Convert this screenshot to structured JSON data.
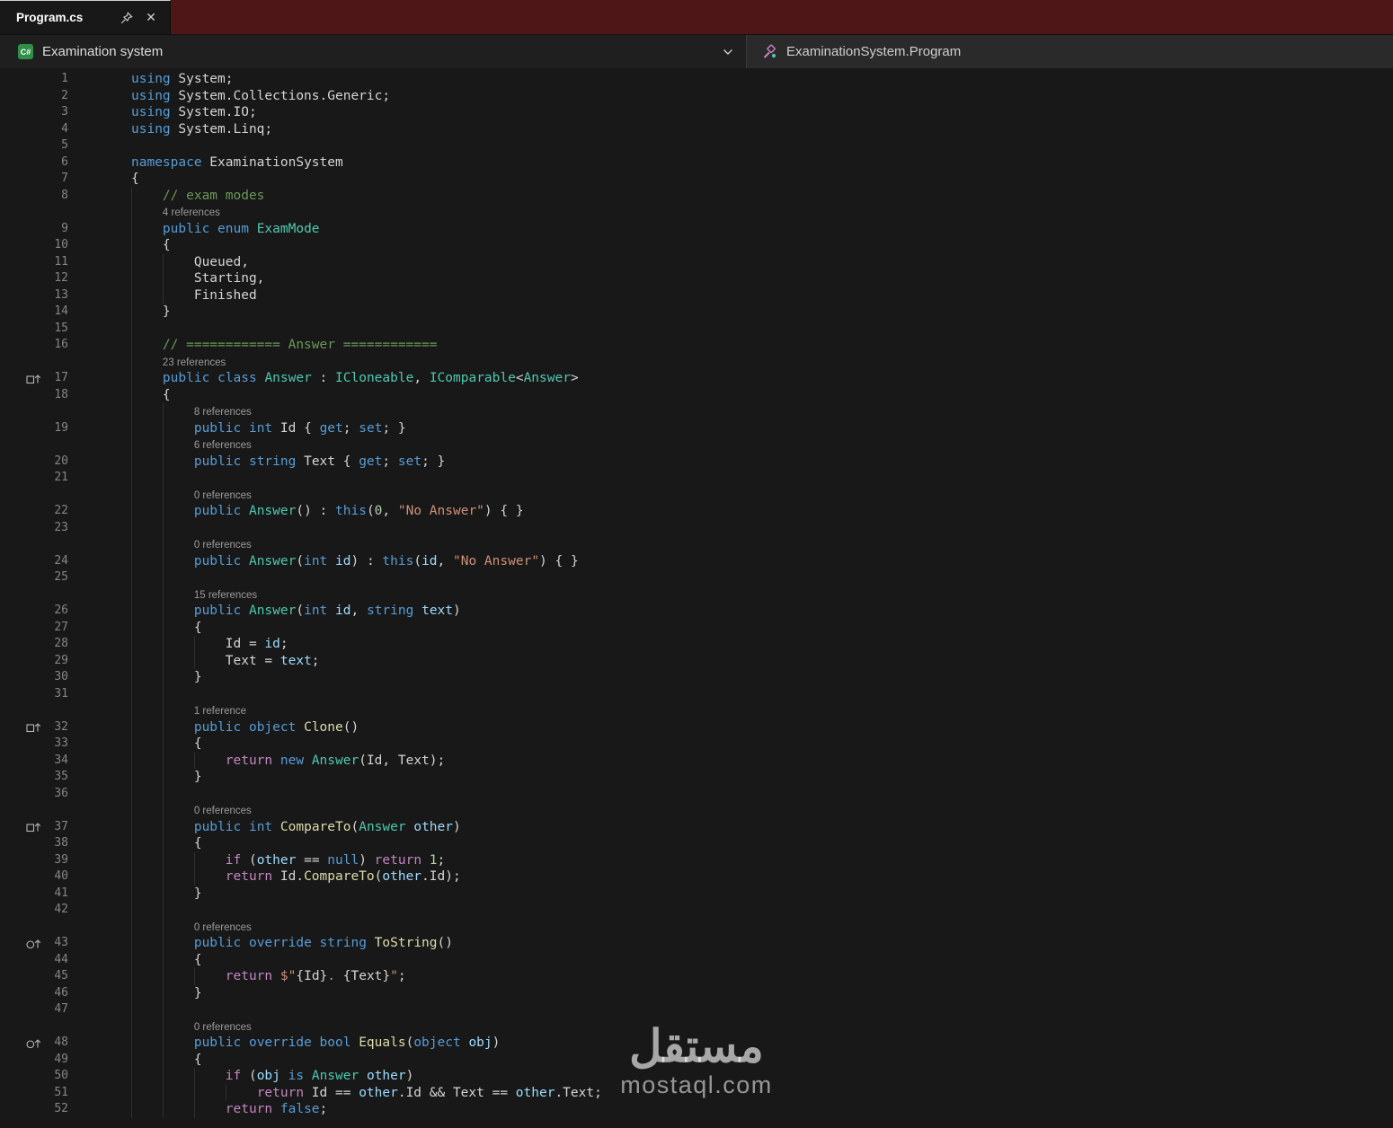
{
  "window": {
    "tab": {
      "title": "Program.cs"
    }
  },
  "navbar": {
    "project_label": "Examination system",
    "symbol_label": "ExaminationSystem.Program"
  },
  "watermark": {
    "arabic": "مستقل",
    "latin": "mostaql.com"
  },
  "colors": {
    "titlebar_fill": "#4e1616",
    "csharp_icon_bg": "#2f8f46",
    "editor_background": "#181818"
  },
  "icons": {
    "pin-icon": "pushpin",
    "close-icon": "✕",
    "chevron-down-icon": "chevron-down",
    "csharp-project-icon": "C#",
    "symbol-class-icon": "class-symbol",
    "implements-icon": "box-up-arrow",
    "override-icon": "circle-up-arrow"
  },
  "editor": {
    "rows": [
      {
        "ln": 1,
        "g": 0,
        "t": [
          [
            "k",
            "using"
          ],
          [
            "p",
            " System;"
          ]
        ]
      },
      {
        "ln": 2,
        "g": 0,
        "t": [
          [
            "k",
            "using"
          ],
          [
            "p",
            " System.Collections.Generic;"
          ]
        ]
      },
      {
        "ln": 3,
        "g": 0,
        "t": [
          [
            "k",
            "using"
          ],
          [
            "p",
            " System.IO;"
          ]
        ]
      },
      {
        "ln": 4,
        "g": 0,
        "t": [
          [
            "k",
            "using"
          ],
          [
            "p",
            " System.Linq;"
          ]
        ]
      },
      {
        "ln": 5,
        "g": 0,
        "t": []
      },
      {
        "ln": 6,
        "g": 0,
        "t": [
          [
            "k",
            "namespace"
          ],
          [
            "p",
            " ExaminationSystem"
          ]
        ]
      },
      {
        "ln": 7,
        "g": 0,
        "t": [
          [
            "p",
            "{"
          ]
        ]
      },
      {
        "ln": 8,
        "g": 1,
        "t": [
          [
            "p",
            "    "
          ],
          [
            "cm",
            "// exam modes"
          ]
        ]
      },
      {
        "lens": "4 references",
        "g": 1,
        "pad": 4
      },
      {
        "ln": 9,
        "g": 1,
        "t": [
          [
            "p",
            "    "
          ],
          [
            "k",
            "public"
          ],
          [
            "p",
            " "
          ],
          [
            "k",
            "enum"
          ],
          [
            "p",
            " "
          ],
          [
            "t",
            "ExamMode"
          ]
        ]
      },
      {
        "ln": 10,
        "g": 1,
        "t": [
          [
            "p",
            "    {"
          ]
        ]
      },
      {
        "ln": 11,
        "g": 2,
        "t": [
          [
            "p",
            "        Queued,"
          ]
        ]
      },
      {
        "ln": 12,
        "g": 2,
        "t": [
          [
            "p",
            "        Starting,"
          ]
        ]
      },
      {
        "ln": 13,
        "g": 2,
        "t": [
          [
            "p",
            "        Finished"
          ]
        ]
      },
      {
        "ln": 14,
        "g": 1,
        "t": [
          [
            "p",
            "    }"
          ]
        ]
      },
      {
        "ln": 15,
        "g": 1,
        "t": []
      },
      {
        "ln": 16,
        "g": 1,
        "t": [
          [
            "p",
            "    "
          ],
          [
            "cm",
            "// ============ Answer ============"
          ]
        ]
      },
      {
        "lens": "23 references",
        "g": 1,
        "pad": 4
      },
      {
        "ln": 17,
        "g": 1,
        "ic": "implements-icon",
        "t": [
          [
            "p",
            "    "
          ],
          [
            "k",
            "public"
          ],
          [
            "p",
            " "
          ],
          [
            "k",
            "class"
          ],
          [
            "p",
            " "
          ],
          [
            "t",
            "Answer"
          ],
          [
            "p",
            " : "
          ],
          [
            "t",
            "ICloneable"
          ],
          [
            "p",
            ", "
          ],
          [
            "t",
            "IComparable"
          ],
          [
            "p",
            "<"
          ],
          [
            "t",
            "Answer"
          ],
          [
            "p",
            ">"
          ]
        ]
      },
      {
        "ln": 18,
        "g": 1,
        "t": [
          [
            "p",
            "    {"
          ]
        ]
      },
      {
        "lens": "8 references",
        "g": 2,
        "pad": 8
      },
      {
        "ln": 19,
        "g": 2,
        "t": [
          [
            "p",
            "        "
          ],
          [
            "k",
            "public"
          ],
          [
            "p",
            " "
          ],
          [
            "k",
            "int"
          ],
          [
            "p",
            " Id { "
          ],
          [
            "k",
            "get"
          ],
          [
            "p",
            "; "
          ],
          [
            "k",
            "set"
          ],
          [
            "p",
            "; }"
          ]
        ]
      },
      {
        "lens": "6 references",
        "g": 2,
        "pad": 8
      },
      {
        "ln": 20,
        "g": 2,
        "t": [
          [
            "p",
            "        "
          ],
          [
            "k",
            "public"
          ],
          [
            "p",
            " "
          ],
          [
            "k",
            "string"
          ],
          [
            "p",
            " Text { "
          ],
          [
            "k",
            "get"
          ],
          [
            "p",
            "; "
          ],
          [
            "k",
            "set"
          ],
          [
            "p",
            "; }"
          ]
        ]
      },
      {
        "ln": 21,
        "g": 2,
        "t": []
      },
      {
        "lens": "0 references",
        "g": 2,
        "pad": 8
      },
      {
        "ln": 22,
        "g": 2,
        "t": [
          [
            "p",
            "        "
          ],
          [
            "k",
            "public"
          ],
          [
            "p",
            " "
          ],
          [
            "t",
            "Answer"
          ],
          [
            "p",
            "() : "
          ],
          [
            "k",
            "this"
          ],
          [
            "p",
            "("
          ],
          [
            "n",
            "0"
          ],
          [
            "p",
            ", "
          ],
          [
            "s",
            "\"No Answer\""
          ],
          [
            "p",
            ") { }"
          ]
        ]
      },
      {
        "ln": 23,
        "g": 2,
        "t": []
      },
      {
        "lens": "0 references",
        "g": 2,
        "pad": 8
      },
      {
        "ln": 24,
        "g": 2,
        "t": [
          [
            "p",
            "        "
          ],
          [
            "k",
            "public"
          ],
          [
            "p",
            " "
          ],
          [
            "t",
            "Answer"
          ],
          [
            "p",
            "("
          ],
          [
            "k",
            "int"
          ],
          [
            "p",
            " "
          ],
          [
            "v",
            "id"
          ],
          [
            "p",
            ") : "
          ],
          [
            "k",
            "this"
          ],
          [
            "p",
            "("
          ],
          [
            "v",
            "id"
          ],
          [
            "p",
            ", "
          ],
          [
            "s",
            "\"No Answer\""
          ],
          [
            "p",
            ") { }"
          ]
        ]
      },
      {
        "ln": 25,
        "g": 2,
        "t": []
      },
      {
        "lens": "15 references",
        "g": 2,
        "pad": 8
      },
      {
        "ln": 26,
        "g": 2,
        "t": [
          [
            "p",
            "        "
          ],
          [
            "k",
            "public"
          ],
          [
            "p",
            " "
          ],
          [
            "t",
            "Answer"
          ],
          [
            "p",
            "("
          ],
          [
            "k",
            "int"
          ],
          [
            "p",
            " "
          ],
          [
            "v",
            "id"
          ],
          [
            "p",
            ", "
          ],
          [
            "k",
            "string"
          ],
          [
            "p",
            " "
          ],
          [
            "v",
            "text"
          ],
          [
            "p",
            ")"
          ]
        ]
      },
      {
        "ln": 27,
        "g": 2,
        "t": [
          [
            "p",
            "        {"
          ]
        ]
      },
      {
        "ln": 28,
        "g": 3,
        "t": [
          [
            "p",
            "            Id = "
          ],
          [
            "v",
            "id"
          ],
          [
            "p",
            ";"
          ]
        ]
      },
      {
        "ln": 29,
        "g": 3,
        "t": [
          [
            "p",
            "            Text = "
          ],
          [
            "v",
            "text"
          ],
          [
            "p",
            ";"
          ]
        ]
      },
      {
        "ln": 30,
        "g": 2,
        "t": [
          [
            "p",
            "        }"
          ]
        ]
      },
      {
        "ln": 31,
        "g": 2,
        "t": []
      },
      {
        "lens": "1 reference",
        "g": 2,
        "pad": 8
      },
      {
        "ln": 32,
        "g": 2,
        "ic": "implements-icon",
        "t": [
          [
            "p",
            "        "
          ],
          [
            "k",
            "public"
          ],
          [
            "p",
            " "
          ],
          [
            "k",
            "object"
          ],
          [
            "p",
            " "
          ],
          [
            "m",
            "Clone"
          ],
          [
            "p",
            "()"
          ]
        ]
      },
      {
        "ln": 33,
        "g": 2,
        "t": [
          [
            "p",
            "        {"
          ]
        ]
      },
      {
        "ln": 34,
        "g": 3,
        "t": [
          [
            "p",
            "            "
          ],
          [
            "c",
            "return"
          ],
          [
            "p",
            " "
          ],
          [
            "k",
            "new"
          ],
          [
            "p",
            " "
          ],
          [
            "t",
            "Answer"
          ],
          [
            "p",
            "(Id, Text);"
          ]
        ]
      },
      {
        "ln": 35,
        "g": 2,
        "t": [
          [
            "p",
            "        }"
          ]
        ]
      },
      {
        "ln": 36,
        "g": 2,
        "t": []
      },
      {
        "lens": "0 references",
        "g": 2,
        "pad": 8
      },
      {
        "ln": 37,
        "g": 2,
        "ic": "implements-icon",
        "t": [
          [
            "p",
            "        "
          ],
          [
            "k",
            "public"
          ],
          [
            "p",
            " "
          ],
          [
            "k",
            "int"
          ],
          [
            "p",
            " "
          ],
          [
            "m",
            "CompareTo"
          ],
          [
            "p",
            "("
          ],
          [
            "t",
            "Answer"
          ],
          [
            "p",
            " "
          ],
          [
            "v",
            "other"
          ],
          [
            "p",
            ")"
          ]
        ]
      },
      {
        "ln": 38,
        "g": 2,
        "t": [
          [
            "p",
            "        {"
          ]
        ]
      },
      {
        "ln": 39,
        "g": 3,
        "t": [
          [
            "p",
            "            "
          ],
          [
            "c",
            "if"
          ],
          [
            "p",
            " ("
          ],
          [
            "v",
            "other"
          ],
          [
            "p",
            " == "
          ],
          [
            "k",
            "null"
          ],
          [
            "p",
            ") "
          ],
          [
            "c",
            "return"
          ],
          [
            "p",
            " "
          ],
          [
            "n",
            "1"
          ],
          [
            "p",
            ";"
          ]
        ]
      },
      {
        "ln": 40,
        "g": 3,
        "t": [
          [
            "p",
            "            "
          ],
          [
            "c",
            "return"
          ],
          [
            "p",
            " Id."
          ],
          [
            "m",
            "CompareTo"
          ],
          [
            "p",
            "("
          ],
          [
            "v",
            "other"
          ],
          [
            "p",
            ".Id);"
          ]
        ]
      },
      {
        "ln": 41,
        "g": 2,
        "t": [
          [
            "p",
            "        }"
          ]
        ]
      },
      {
        "ln": 42,
        "g": 2,
        "t": []
      },
      {
        "lens": "0 references",
        "g": 2,
        "pad": 8
      },
      {
        "ln": 43,
        "g": 2,
        "ic": "override-icon",
        "t": [
          [
            "p",
            "        "
          ],
          [
            "k",
            "public"
          ],
          [
            "p",
            " "
          ],
          [
            "k",
            "override"
          ],
          [
            "p",
            " "
          ],
          [
            "k",
            "string"
          ],
          [
            "p",
            " "
          ],
          [
            "m",
            "ToString"
          ],
          [
            "p",
            "()"
          ]
        ]
      },
      {
        "ln": 44,
        "g": 2,
        "t": [
          [
            "p",
            "        {"
          ]
        ]
      },
      {
        "ln": 45,
        "g": 3,
        "t": [
          [
            "p",
            "            "
          ],
          [
            "c",
            "return"
          ],
          [
            "p",
            " "
          ],
          [
            "s",
            "$\""
          ],
          [
            "p",
            "{Id}"
          ],
          [
            "s",
            ". "
          ],
          [
            "p",
            "{Text}"
          ],
          [
            "s",
            "\""
          ],
          [
            "p",
            ";"
          ]
        ]
      },
      {
        "ln": 46,
        "g": 2,
        "t": [
          [
            "p",
            "        }"
          ]
        ]
      },
      {
        "ln": 47,
        "g": 2,
        "t": []
      },
      {
        "lens": "0 references",
        "g": 2,
        "pad": 8
      },
      {
        "ln": 48,
        "g": 2,
        "ic": "override-icon",
        "t": [
          [
            "p",
            "        "
          ],
          [
            "k",
            "public"
          ],
          [
            "p",
            " "
          ],
          [
            "k",
            "override"
          ],
          [
            "p",
            " "
          ],
          [
            "k",
            "bool"
          ],
          [
            "p",
            " "
          ],
          [
            "m",
            "Equals"
          ],
          [
            "p",
            "("
          ],
          [
            "k",
            "object"
          ],
          [
            "p",
            " "
          ],
          [
            "v",
            "obj"
          ],
          [
            "p",
            ")"
          ]
        ]
      },
      {
        "ln": 49,
        "g": 2,
        "t": [
          [
            "p",
            "        {"
          ]
        ]
      },
      {
        "ln": 50,
        "g": 3,
        "t": [
          [
            "p",
            "            "
          ],
          [
            "c",
            "if"
          ],
          [
            "p",
            " ("
          ],
          [
            "v",
            "obj"
          ],
          [
            "p",
            " "
          ],
          [
            "k",
            "is"
          ],
          [
            "p",
            " "
          ],
          [
            "t",
            "Answer"
          ],
          [
            "p",
            " "
          ],
          [
            "v",
            "other"
          ],
          [
            "p",
            ")"
          ]
        ]
      },
      {
        "ln": 51,
        "g": 4,
        "t": [
          [
            "p",
            "                "
          ],
          [
            "c",
            "return"
          ],
          [
            "p",
            " Id == "
          ],
          [
            "v",
            "other"
          ],
          [
            "p",
            ".Id && Text == "
          ],
          [
            "v",
            "other"
          ],
          [
            "p",
            ".Text;"
          ]
        ]
      },
      {
        "ln": 52,
        "g": 3,
        "t": [
          [
            "p",
            "            "
          ],
          [
            "c",
            "return"
          ],
          [
            "p",
            " "
          ],
          [
            "k",
            "false"
          ],
          [
            "p",
            ";"
          ]
        ]
      }
    ]
  }
}
